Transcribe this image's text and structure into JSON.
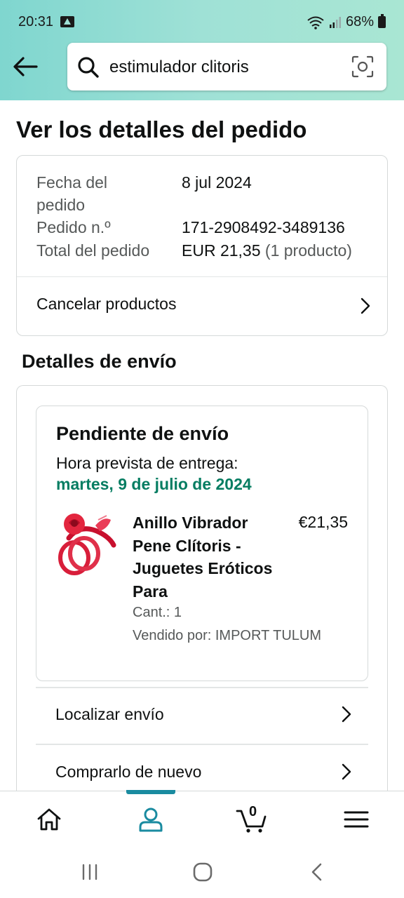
{
  "status_bar": {
    "time": "20:31",
    "battery": "68%"
  },
  "search": {
    "query": "estimulador clitoris"
  },
  "page": {
    "title": "Ver los detalles del pedido"
  },
  "order_summary": {
    "date_label_1": "Fecha del",
    "date_label_2": "pedido",
    "date_value": "8 jul 2024",
    "order_number_label": "Pedido n.º",
    "order_number_value": "171-2908492-3489136",
    "total_label": "Total del pedido",
    "total_value": "EUR 21,35",
    "total_items": "(1 producto)",
    "cancel_label": "Cancelar productos"
  },
  "shipping": {
    "section_title": "Detalles de envío",
    "status": "Pendiente de envío",
    "eta_label": "Hora prevista de entrega:",
    "eta_date": "martes, 9 de julio de 2024",
    "product": {
      "title_lines": [
        "Anillo Vibrador",
        "Pene Clítoris -",
        "Juguetes Eróticos",
        "Para"
      ],
      "price": "€21,35",
      "quantity": "Cant.: 1",
      "seller": "Vendido por: IMPORT TULUM"
    },
    "track_label": "Localizar envío",
    "buy_again_label": "Comprarlo de nuevo"
  },
  "bottom_nav": {
    "cart_count": "0"
  },
  "colors": {
    "accent": "#1a8ba0",
    "eta_green": "#067d62",
    "header_gradient_start": "#7fd6cf",
    "header_gradient_end": "#a9e6d3"
  }
}
